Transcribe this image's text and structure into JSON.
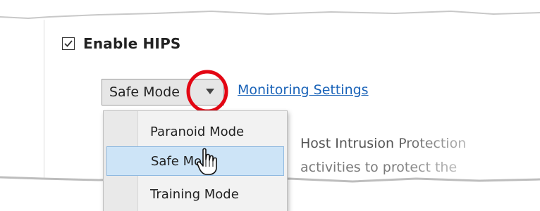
{
  "hips": {
    "enable_label": "Enable HIPS",
    "checked": true
  },
  "mode_select": {
    "selected_value": "Safe Mode",
    "arrow_icon": "dropdown-arrow-icon"
  },
  "monitoring_link": "Monitoring Settings",
  "dropdown": {
    "options": [
      {
        "label": "Paranoid Mode",
        "selected": false
      },
      {
        "label": "Safe Mode",
        "selected": true
      },
      {
        "label": "Training Mode",
        "selected": false
      }
    ]
  },
  "background_text": {
    "line1": "Host Intrusion Protection",
    "line2": "activities to protect the"
  },
  "colors": {
    "link": "#1a63b8",
    "selection_fill": "#cde4f7",
    "highlight_circle": "#e30613"
  }
}
